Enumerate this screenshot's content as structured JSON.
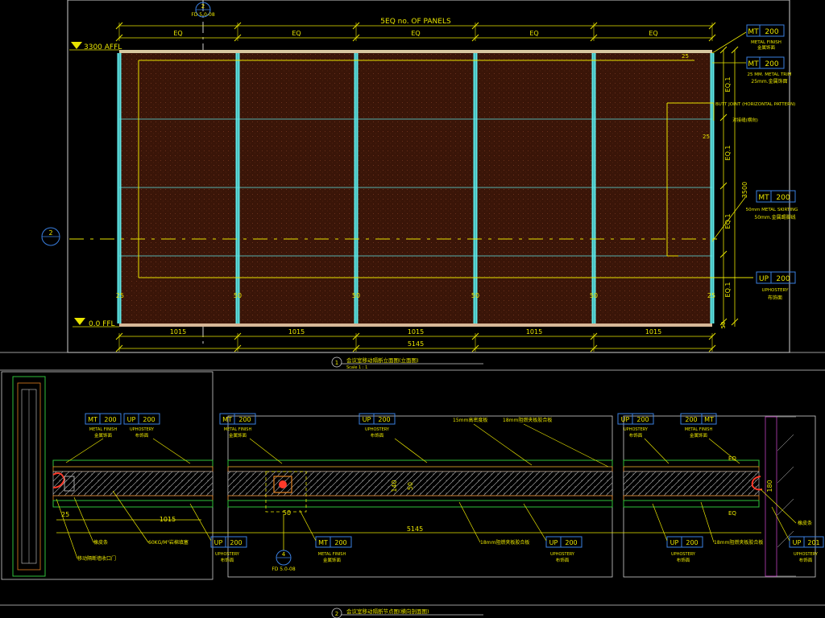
{
  "colors": {
    "background": "#000000",
    "frame": "#cfcfcf",
    "yellow": "#e8e400",
    "cyan": "#5fe6e6",
    "panel_fill": "#3a1508",
    "panel_dot": "#7a3a22",
    "tag_blue": "#3a7fe0",
    "green": "#2fbf3a",
    "orange": "#e08020",
    "red": "#ff3a2a",
    "magenta": "#c040c0"
  },
  "elevation": {
    "top_marker": {
      "num": "2",
      "ref": "FD 5.0-08"
    },
    "header": "5EQ no. OF PANELS",
    "eq_labels": [
      "EQ",
      "EQ",
      "EQ",
      "EQ",
      "EQ"
    ],
    "level_top": "3300 AFFL",
    "level_bottom": "0.0 FFL",
    "left_section": "2",
    "mullion_dims": [
      "25",
      "50",
      "50",
      "50",
      "50",
      "25"
    ],
    "panel_widths": [
      "1015",
      "1015",
      "1015",
      "1015",
      "1015"
    ],
    "total_width": "5145",
    "right_eq": [
      "EQ.1",
      "EQ.1",
      "EQ.1",
      "EQ.1"
    ],
    "right_dims": {
      "top": "25",
      "upper": "25",
      "height": "3500",
      "bottom": "50"
    },
    "callouts": [
      {
        "code": "MT",
        "num": "200",
        "en": "METAL FINISH",
        "cn": "金属饰面"
      },
      {
        "code": "MT",
        "num": "200",
        "en": "25 MM. METAL TRIM",
        "cn": "25mm.金属饰面"
      },
      {
        "code": "",
        "num": "",
        "en": "BUTT JOINT (HORIZONTAL PATTERN)",
        "cn": "对接缝(横向)"
      },
      {
        "code": "MT",
        "num": "200",
        "en": "50mm METAL SKIRTING",
        "cn": "50mm.金属踢脚线"
      },
      {
        "code": "UP",
        "num": "200",
        "en": "UPHOSTERY",
        "cn": "布饰面"
      }
    ],
    "title_num": "1",
    "title": "会议室移动隔断立面图(立面图)",
    "scale": "Scale 1 : 1"
  },
  "plan": {
    "left_tags": [
      {
        "code": "MT",
        "num": "200",
        "en": "METAL FINISH",
        "cn": "金属饰面"
      },
      {
        "code": "UP",
        "num": "200",
        "en": "UPHOSTERY",
        "cn": "布饰面"
      }
    ],
    "mid_left_tag": {
      "code": "MT",
      "num": "200",
      "en": "METAL FINISH",
      "cn": "金属饰面"
    },
    "mid_tag": {
      "code": "UP",
      "num": "200",
      "en": "UPHOSTERY",
      "cn": "布饰面"
    },
    "top_notes": [
      "15mm高密度板",
      "18mm阻燃夹板胶合板"
    ],
    "right_tags": [
      {
        "code": "UP",
        "num": "200",
        "en": "UPHOSTERY",
        "cn": "布饰面"
      },
      {
        "code": "MT",
        "num": "200",
        "en": "METAL FINISH",
        "cn": "金属饰面"
      }
    ],
    "right_tag2": {
      "code": "200",
      "num": "MT"
    },
    "dims": {
      "d25": "25",
      "d1015": "1015",
      "d5145": "5145",
      "d50": "50",
      "d140": "140",
      "d50b": "50",
      "d180": "180",
      "eq1": "EQ",
      "eq2": "EQ"
    },
    "notes": [
      "橡皮条",
      "60KG/M³岩棉填塞",
      "18mm阻燃夹板胶合板",
      "18mm阻燃夹板胶合板",
      "橡皮条"
    ],
    "left_note": "移动隔断墙收口门",
    "bottom_tags": [
      {
        "code": "UP",
        "num": "200",
        "en": "UPHOSTERY",
        "cn": "布饰面"
      },
      {
        "code": "MT",
        "num": "200",
        "en": "METAL FINISH",
        "cn": "金属饰面"
      },
      {
        "code": "UP",
        "num": "200",
        "en": "UPHOSTERY",
        "cn": "布饰面"
      },
      {
        "code": "UP",
        "num": "200",
        "en": "UPHOSTERY",
        "cn": "布饰面"
      },
      {
        "code": "UP",
        "num": "201",
        "en": "UPHOSTERY",
        "cn": "布饰面"
      }
    ],
    "detail_marker": {
      "num": "4",
      "ref": "FD 5.0-08"
    },
    "title_num": "2",
    "title": "会议室移动隔断节点图(横向剖面图)"
  }
}
